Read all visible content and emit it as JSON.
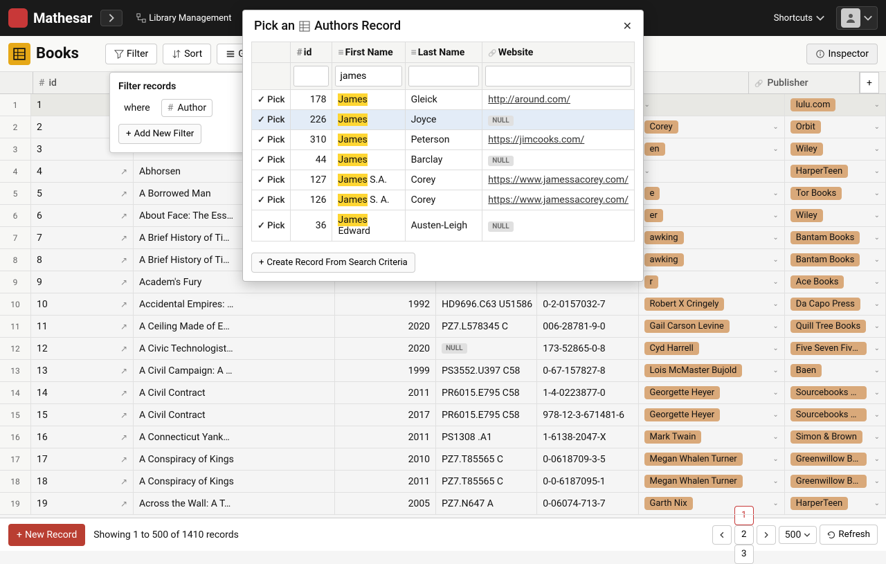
{
  "app": {
    "name": "Mathesar",
    "db": "Library Management",
    "shortcuts": "Shortcuts"
  },
  "table": {
    "name": "Books"
  },
  "toolbar": {
    "filter": "Filter",
    "sort": "Sort",
    "group": "Grou",
    "inspector": "Inspector"
  },
  "filter_panel": {
    "title": "Filter records",
    "where": "where",
    "field": "Author",
    "add": "Add New Filter"
  },
  "columns": {
    "id": "id",
    "publisher": "Publisher"
  },
  "rows": [
    {
      "n": 1,
      "id": "1",
      "title": "",
      "year": "",
      "call": "",
      "isbn": "",
      "author": "",
      "publisher": "lulu.com"
    },
    {
      "n": 2,
      "id": "2",
      "title": "",
      "year": "",
      "call": "",
      "isbn": "",
      "author": "Corey",
      "publisher": "Orbit"
    },
    {
      "n": 3,
      "id": "3",
      "title": "",
      "year": "",
      "call": "",
      "isbn": "",
      "author": "en",
      "publisher": "Wiley"
    },
    {
      "n": 4,
      "id": "4",
      "title": "Abhorsen",
      "year": "",
      "call": "",
      "isbn": "",
      "author": "",
      "publisher": "HarperTeen"
    },
    {
      "n": 5,
      "id": "5",
      "title": "A Borrowed Man",
      "year": "",
      "call": "",
      "isbn": "",
      "author": "e",
      "publisher": "Tor Books"
    },
    {
      "n": 6,
      "id": "6",
      "title": "About Face: The Ess…",
      "year": "",
      "call": "",
      "isbn": "",
      "author": "er",
      "publisher": "Wiley"
    },
    {
      "n": 7,
      "id": "7",
      "title": "A Brief History of Ti…",
      "year": "",
      "call": "",
      "isbn": "",
      "author": "awking",
      "publisher": "Bantam Books"
    },
    {
      "n": 8,
      "id": "8",
      "title": "A Brief History of Ti…",
      "year": "",
      "call": "",
      "isbn": "",
      "author": "awking",
      "publisher": "Bantam Books"
    },
    {
      "n": 9,
      "id": "9",
      "title": "Academ's Fury",
      "year": "",
      "call": "",
      "isbn": "",
      "author": "r",
      "publisher": "Ace Books"
    },
    {
      "n": 10,
      "id": "10",
      "title": "Accidental Empires: …",
      "year": "1992",
      "call": "HD9696.C63 U51586",
      "isbn": "0-2-0157032-7",
      "author": "Robert X Cringely",
      "publisher": "Da Capo Press"
    },
    {
      "n": 11,
      "id": "11",
      "title": "A Ceiling Made of E…",
      "year": "2020",
      "call": "PZ7.L578345 C",
      "isbn": "006-28781-9-0",
      "author": "Gail Carson Levine",
      "publisher": "Quill Tree Books"
    },
    {
      "n": 12,
      "id": "12",
      "title": "A Civic Technologist…",
      "year": "2020",
      "call": "NULL",
      "isbn": "173-52865-0-8",
      "author": "Cyd Harrell",
      "publisher": "Five Seven Five…"
    },
    {
      "n": 13,
      "id": "13",
      "title": "A Civil Campaign: A …",
      "year": "1999",
      "call": "PS3552.U397 C58",
      "isbn": "0-67-157827-8",
      "author": "Lois McMaster Bujold",
      "publisher": "Baen"
    },
    {
      "n": 14,
      "id": "14",
      "title": "A Civil Contract",
      "year": "2011",
      "call": "PR6015.E795 C58",
      "isbn": "1-4-0223877-0",
      "author": "Georgette Heyer",
      "publisher": "Sourcebooks C…"
    },
    {
      "n": 15,
      "id": "15",
      "title": "A Civil Contract",
      "year": "2017",
      "call": "PR6015.E795 C58",
      "isbn": "978-12-3-671481-6",
      "author": "Georgette Heyer",
      "publisher": "Sourcebooks C…"
    },
    {
      "n": 16,
      "id": "16",
      "title": "A Connecticut Yank…",
      "year": "2011",
      "call": "PS1308 .A1",
      "isbn": "1-6138-2047-X",
      "author": "Mark Twain",
      "publisher": "Simon & Brown"
    },
    {
      "n": 17,
      "id": "17",
      "title": "A Conspiracy of Kings",
      "year": "2010",
      "call": "PZ7.T85565 C",
      "isbn": "0-0618709-3-5",
      "author": "Megan Whalen Turner",
      "publisher": "Greenwillow Bo…"
    },
    {
      "n": 18,
      "id": "18",
      "title": "A Conspiracy of Kings",
      "year": "2011",
      "call": "PZ7.T85565 C",
      "isbn": "0-0-6187095-1",
      "author": "Megan Whalen Turner",
      "publisher": "Greenwillow Bo…"
    },
    {
      "n": 19,
      "id": "19",
      "title": "Across the Wall: A T…",
      "year": "2005",
      "call": "PZ7.N647 A",
      "isbn": "0-06074-713-7",
      "author": "Garth Nix",
      "publisher": "HarperTeen"
    }
  ],
  "modal": {
    "title_prefix": "Pick an",
    "title_entity": "Authors Record",
    "cols": {
      "id": "id",
      "first": "First Name",
      "last": "Last Name",
      "site": "Website"
    },
    "search_value": "james",
    "pick": "Pick",
    "null": "NULL",
    "create": "Create Record From Search Criteria",
    "results": [
      {
        "id": "178",
        "first_hl": "James",
        "first_rest": "",
        "last": "Gleick",
        "site": "http://around.com/"
      },
      {
        "id": "226",
        "first_hl": "James",
        "first_rest": "",
        "last": "Joyce",
        "site": null,
        "highlighted": true
      },
      {
        "id": "310",
        "first_hl": "James",
        "first_rest": "",
        "last": "Peterson",
        "site": "https://jimcooks.com/"
      },
      {
        "id": "44",
        "first_hl": "James",
        "first_rest": "",
        "last": "Barclay",
        "site": null
      },
      {
        "id": "127",
        "first_hl": "James",
        "first_rest": " S.A.",
        "last": "Corey",
        "site": "https://www.jamessacorey.com/"
      },
      {
        "id": "126",
        "first_hl": "James",
        "first_rest": " S. A.",
        "last": "Corey",
        "site": "https://www.jamessacorey.com/"
      },
      {
        "id": "36",
        "first_hl": "James",
        "first_rest": " Edward",
        "last": "Austen-Leigh",
        "site": null
      }
    ]
  },
  "footer": {
    "new_record": "New Record",
    "showing": "Showing 1 to 500 of 1410 records",
    "pages": [
      "1",
      "2",
      "3"
    ],
    "active_page": "1",
    "page_size": "500",
    "refresh": "Refresh"
  }
}
